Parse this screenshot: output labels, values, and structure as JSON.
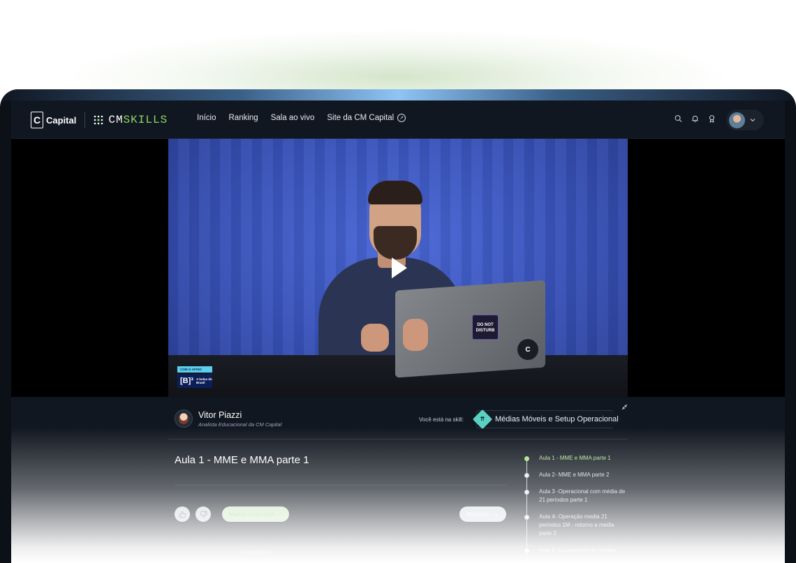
{
  "nav": {
    "capital_letter": "C",
    "capital_label": "Capital",
    "skills_prefix": "CM",
    "skills_suffix": "SKILLS",
    "links": [
      "Início",
      "Ranking",
      "Sala ao vivo",
      "Site da CM Capital"
    ]
  },
  "video": {
    "badge_top": "COM O APOIO",
    "badge_b3": "[B]³",
    "badge_text": "A bolsa do Brasil",
    "sticker_text": "DO NOT DISTURB",
    "sticker_c": "C"
  },
  "instructor": {
    "name": "Vitor Piazzi",
    "role": "Analista Educacional da CM Capital"
  },
  "skill": {
    "label": "Você está na skill:",
    "name": "Médias Móveis e Setup Operacional"
  },
  "lesson": {
    "title": "Aula 1 - MME e MMA parte 1",
    "complete_label": "Marcar como visto",
    "next_label": "Próximo",
    "comments_label": "Comentários"
  },
  "timeline": [
    {
      "label": "Aula 1 - MME e MMA parte 1",
      "active": true
    },
    {
      "label": "Aula 2- MME e MMA parte 2",
      "active": false
    },
    {
      "label": "Aula 3 -Operacional com média de 21 períodos parte 1",
      "active": false
    },
    {
      "label": "Aula 4- Operação media 21 períodos 1M - retorno a media parte 2",
      "active": false
    },
    {
      "label": "Aula 5- Cruzamento de médias",
      "active": false
    }
  ],
  "colors": {
    "accent_green": "#a9e08b",
    "skill_teal": "#5bd1c3",
    "nav_bg": "#111720",
    "video_blue": "#3a55bd"
  }
}
